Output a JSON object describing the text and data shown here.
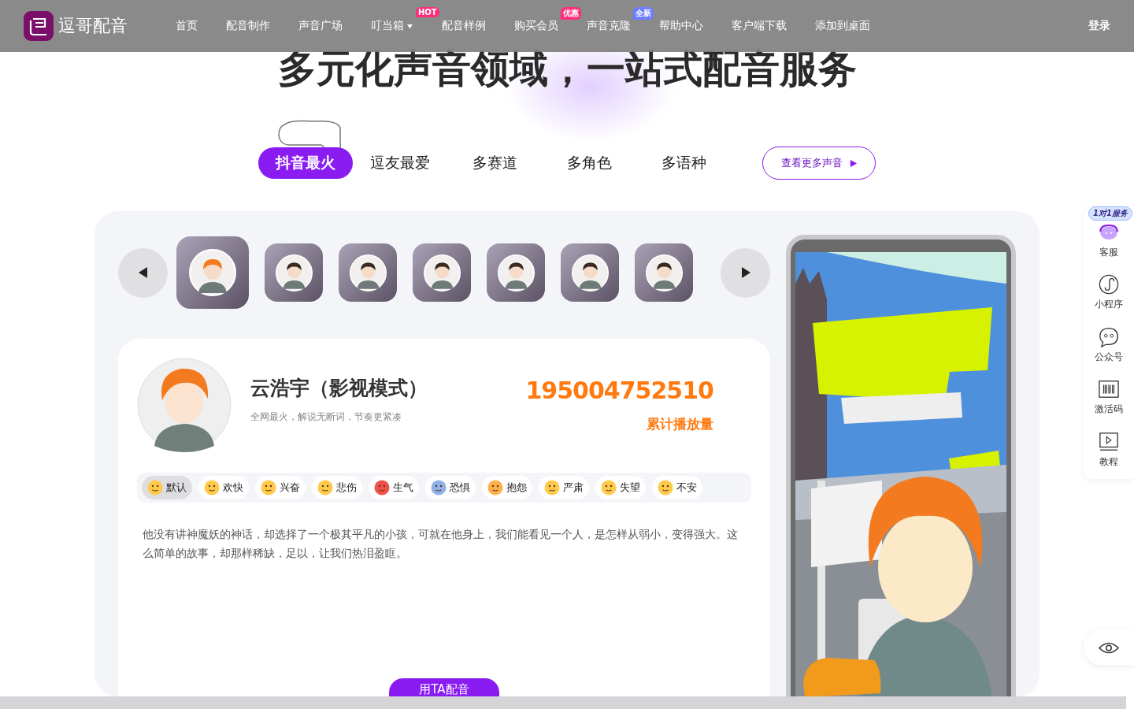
{
  "header": {
    "logo_text": "逗哥配音",
    "nav": [
      {
        "label": "首页",
        "dropdown": false
      },
      {
        "label": "配音制作",
        "dropdown": false
      },
      {
        "label": "声音广场",
        "dropdown": false
      },
      {
        "label": "叮当箱",
        "dropdown": true,
        "badge": {
          "text": "HOT",
          "color": "#ff2d7a"
        }
      },
      {
        "label": "配音样例",
        "dropdown": false
      },
      {
        "label": "购买会员",
        "dropdown": false,
        "badge": {
          "text": "优惠",
          "color": "#ff2d7a"
        }
      },
      {
        "label": "声音克隆",
        "dropdown": false,
        "badge": {
          "text": "全新",
          "color": "#6e7cff"
        }
      },
      {
        "label": "帮助中心",
        "dropdown": false
      },
      {
        "label": "客户端下载",
        "dropdown": false
      },
      {
        "label": "添加到桌面",
        "dropdown": false
      }
    ],
    "login": "登录"
  },
  "hero": {
    "title": "多元化声音领域，一站式配音服务"
  },
  "tabs": [
    {
      "label": "抖音最火",
      "selected": true
    },
    {
      "label": "逗友最爱",
      "selected": false
    },
    {
      "label": "多赛道",
      "selected": false
    },
    {
      "label": "多角色",
      "selected": false
    },
    {
      "label": "多语种",
      "selected": false
    }
  ],
  "more_button": "查看更多声音",
  "voices": [
    {
      "selected": true
    },
    {
      "selected": false
    },
    {
      "selected": false
    },
    {
      "selected": false
    },
    {
      "selected": false
    },
    {
      "selected": false
    },
    {
      "selected": false
    }
  ],
  "card": {
    "name": "云浩宇（影视模式）",
    "subtitle": "全网最火，解说无断词，节奏更紧凑",
    "play_count": "195004752510",
    "play_count_label": "累计播放量",
    "emotions": [
      {
        "label": "默认",
        "selected": true,
        "color": "#ffc94a"
      },
      {
        "label": "欢快",
        "selected": false,
        "color": "#ffc94a"
      },
      {
        "label": "兴奋",
        "selected": false,
        "color": "#ffc94a"
      },
      {
        "label": "悲伤",
        "selected": false,
        "color": "#ffc94a"
      },
      {
        "label": "生气",
        "selected": false,
        "color": "#f0504a"
      },
      {
        "label": "恐惧",
        "selected": false,
        "color": "#8fb0e8"
      },
      {
        "label": "抱怨",
        "selected": false,
        "color": "#ffb04a"
      },
      {
        "label": "严肃",
        "selected": false,
        "color": "#ffc94a"
      },
      {
        "label": "失望",
        "selected": false,
        "color": "#ffc94a"
      },
      {
        "label": "不安",
        "selected": false,
        "color": "#ffc94a"
      }
    ],
    "description": "他没有讲神魔妖的神话，却选择了一个极其平凡的小孩，可就在他身上，我们能看见一个人，是怎样从弱小，变得强大。这么简单的故事，却那样稀缺，足以，让我们热泪盈眶。",
    "use_button": "用TA配音"
  },
  "sidebar": {
    "badge": "1对1服务",
    "items": [
      {
        "label": "客服",
        "kind": "service"
      },
      {
        "label": "小程序",
        "kind": "miniapp"
      },
      {
        "label": "公众号",
        "kind": "chat"
      },
      {
        "label": "激活码",
        "kind": "barcode"
      },
      {
        "label": "教程",
        "kind": "video"
      }
    ]
  }
}
